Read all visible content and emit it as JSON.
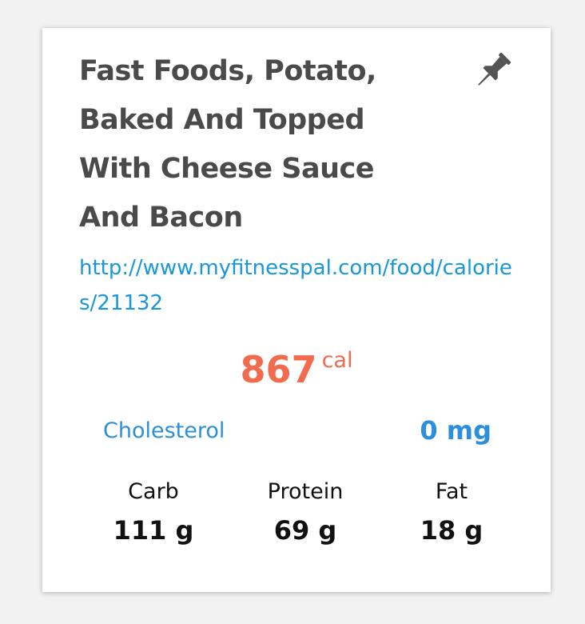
{
  "food": {
    "title": "Fast Foods, Potato, Baked And Topped With Cheese Sauce And Bacon",
    "url": "http://www.myfitnesspal.com/food/calories/21132",
    "calories": "867",
    "calories_unit": "cal",
    "cholesterol_label": "Cholesterol",
    "cholesterol_value": "0 mg",
    "macros": [
      {
        "label": "Carb",
        "value": "111 g"
      },
      {
        "label": "Protein",
        "value": "69 g"
      },
      {
        "label": "Fat",
        "value": "18 g"
      }
    ]
  },
  "icons": {
    "pin": "pushpin-icon"
  },
  "colors": {
    "title": "#4a4a4a",
    "link": "#1a97d8",
    "calories": "#f36b4f",
    "cholesterol": "#2b8fdc",
    "macros": "#111111",
    "pin_icon": "#555555"
  }
}
